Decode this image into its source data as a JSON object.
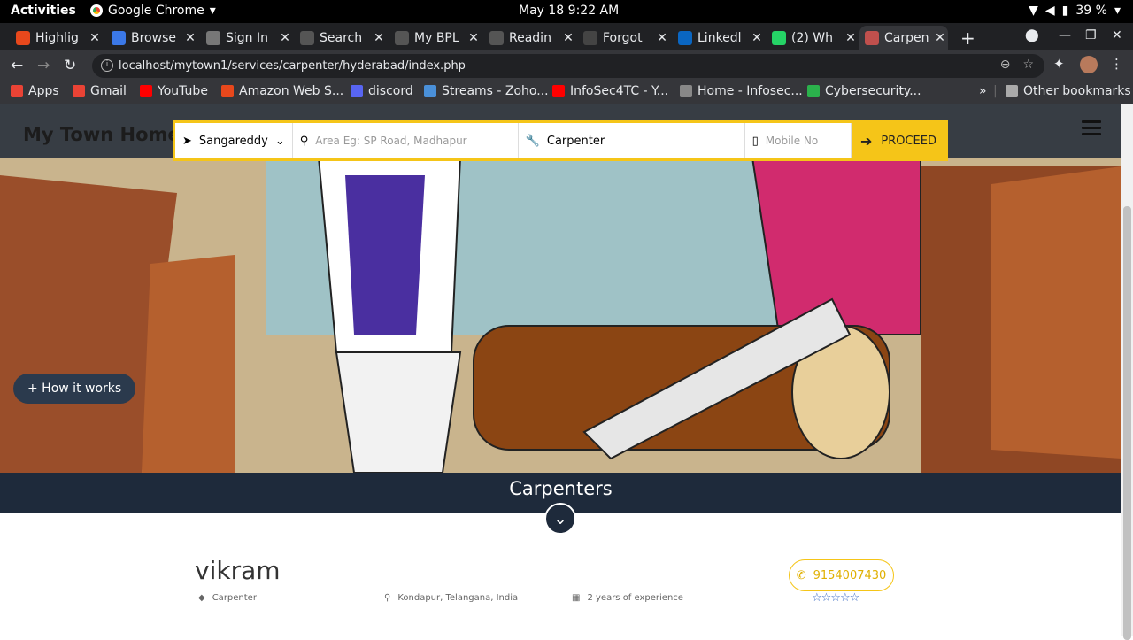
{
  "os": {
    "activities": "Activities",
    "app_name": "Google Chrome",
    "clock": "May 18  9:22 AM",
    "battery": "39 %"
  },
  "tabs": [
    {
      "title": "Highlig",
      "color": "#e8481c"
    },
    {
      "title": "Browse",
      "color": "#3b78e7"
    },
    {
      "title": "Sign In",
      "color": "#777"
    },
    {
      "title": "Search",
      "color": "#555"
    },
    {
      "title": "My BPL",
      "color": "#555"
    },
    {
      "title": "Readin",
      "color": "#555"
    },
    {
      "title": "Forgot",
      "color": "#444"
    },
    {
      "title": "Linkedl",
      "color": "#0a66c2"
    },
    {
      "title": "(2) Wh",
      "color": "#25d366"
    },
    {
      "title": "Carpen",
      "color": "#c0504d"
    }
  ],
  "browser": {
    "url": "localhost/mytown1/services/carpenter/hyderabad/index.php"
  },
  "bookmarks": [
    {
      "label": "Apps",
      "color": "#ea4335"
    },
    {
      "label": "Gmail",
      "color": "#ea4335"
    },
    {
      "label": "YouTube",
      "color": "#ff0000"
    },
    {
      "label": "Amazon Web S...",
      "color": "#e8481c"
    },
    {
      "label": "discord",
      "color": "#5865f2"
    },
    {
      "label": "Streams - Zoho...",
      "color": "#4a90d9"
    },
    {
      "label": "InfoSec4TC - Y...",
      "color": "#ff0000"
    },
    {
      "label": "Home - Infosec...",
      "color": "#888"
    },
    {
      "label": "Cybersecurity...",
      "color": "#2bb24c"
    }
  ],
  "bookmarks_more": "»",
  "other_bookmarks": "Other bookmarks",
  "site": {
    "logo": "My Town Home",
    "search": {
      "city": "Sangareddy",
      "area_placeholder": "Area Eg: SP Road, Madhapur",
      "service": "Carpenter",
      "mobile_placeholder": "Mobile No",
      "proceed": "PROCEED"
    },
    "how_it_works": "+ How it works",
    "section_title": "Carpenters",
    "listing": {
      "name": "vikram",
      "category": "Carpenter",
      "location": "Kondapur, Telangana, India",
      "experience": "2 years of experience",
      "phone": "9154007430",
      "rating_stars": "☆☆☆☆☆"
    }
  }
}
